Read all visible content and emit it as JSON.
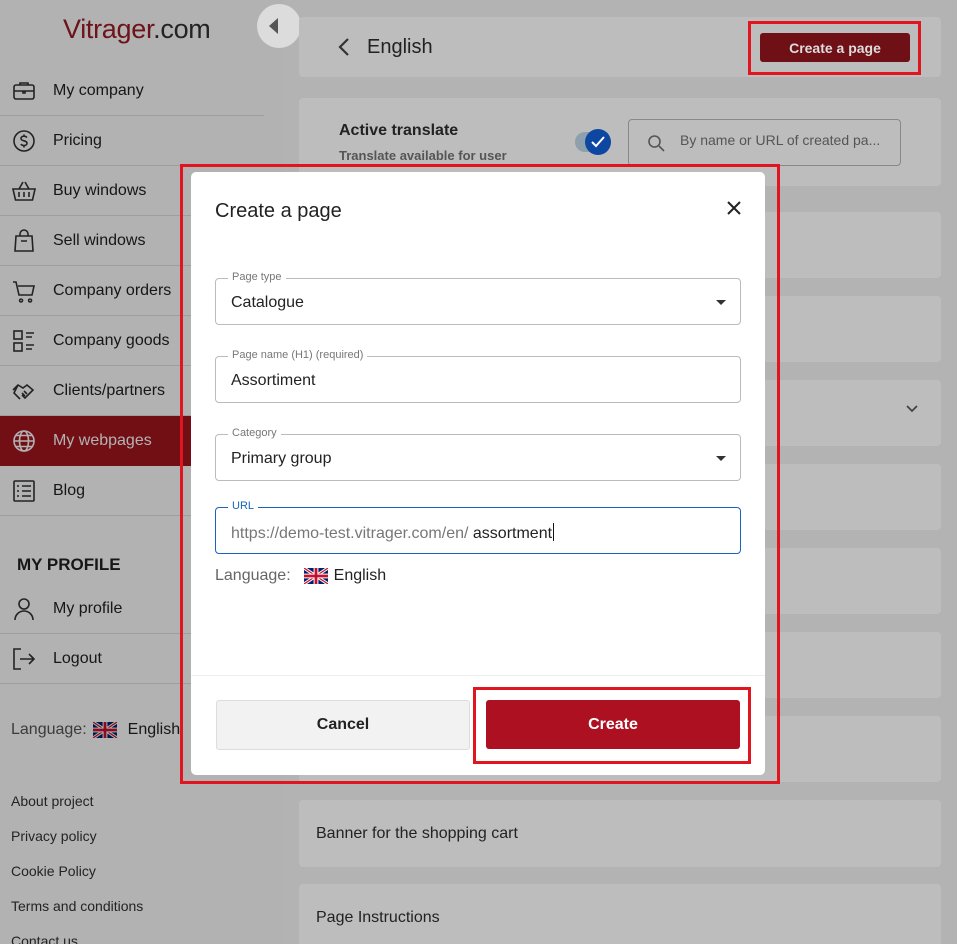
{
  "sidebar": {
    "logo_main": "Vitrager",
    "logo_suffix": ".com",
    "menu": [
      {
        "label": "My company",
        "icon": "briefcase-icon"
      },
      {
        "label": "Pricing",
        "icon": "dollar-circle-icon"
      },
      {
        "label": "Buy windows",
        "icon": "basket-icon"
      },
      {
        "label": "Sell windows",
        "icon": "shopping-bag-icon"
      },
      {
        "label": "Company orders",
        "icon": "cart-icon"
      },
      {
        "label": "Company goods",
        "icon": "grid-list-icon"
      },
      {
        "label": "Clients/partners",
        "icon": "handshake-icon"
      },
      {
        "label": "My webpages",
        "icon": "globe-icon",
        "active": true
      },
      {
        "label": "Blog",
        "icon": "blog-list-icon"
      }
    ],
    "profile_title": "MY PROFILE",
    "profile_menu": [
      {
        "label": "My profile",
        "icon": "user-icon"
      },
      {
        "label": "Logout",
        "icon": "logout-icon"
      }
    ],
    "language_label": "Language:",
    "language_value": "English",
    "footer_links": [
      "About project",
      "Privacy policy",
      "Cookie Policy",
      "Terms and conditions",
      "Contact us"
    ]
  },
  "header": {
    "title": "English",
    "create_button": "Create a page"
  },
  "translate": {
    "title": "Active translate",
    "subtitle": "Translate available for user",
    "toggle_on": true,
    "search_placeholder": "By name or URL of created pa..."
  },
  "rows": {
    "banner": "Banner for the shopping cart",
    "instructions": "Page Instructions"
  },
  "modal": {
    "title": "Create a page",
    "page_type_label": "Page type",
    "page_type_value": "Catalogue",
    "page_name_label": "Page name (H1) (required)",
    "page_name_value": "Assortiment",
    "category_label": "Category",
    "category_value": "Primary group",
    "url_label": "URL",
    "url_prefix": "https://demo-test.vitrager.com/en/",
    "url_value": "assortment",
    "language_label": "Language:",
    "language_value": "English",
    "cancel_button": "Cancel",
    "create_button": "Create"
  },
  "colors": {
    "brand": "#a3161f",
    "create_button": "#ad1020",
    "highlight": "#e0151f",
    "focus": "#1565c0"
  }
}
